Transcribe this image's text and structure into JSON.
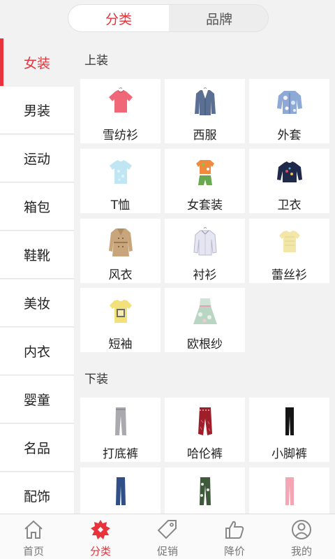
{
  "header": {
    "tabs": [
      {
        "label": "分类",
        "active": true
      },
      {
        "label": "品牌",
        "active": false
      }
    ]
  },
  "sidebar": {
    "items": [
      {
        "label": "女装",
        "active": true
      },
      {
        "label": "男装"
      },
      {
        "label": "运动"
      },
      {
        "label": "箱包"
      },
      {
        "label": "鞋靴"
      },
      {
        "label": "美妆"
      },
      {
        "label": "内衣"
      },
      {
        "label": "婴童"
      },
      {
        "label": "名品"
      },
      {
        "label": "配饰"
      }
    ]
  },
  "sections": [
    {
      "title": "上装",
      "items": [
        {
          "label": "雪纺衫",
          "icon": "chiffon-shirt-icon"
        },
        {
          "label": "西服",
          "icon": "blazer-icon"
        },
        {
          "label": "外套",
          "icon": "jacket-icon"
        },
        {
          "label": "T恤",
          "icon": "tshirt-icon"
        },
        {
          "label": "女套装",
          "icon": "women-suit-icon"
        },
        {
          "label": "卫衣",
          "icon": "sweatshirt-icon"
        },
        {
          "label": "风衣",
          "icon": "trench-coat-icon"
        },
        {
          "label": "衬衫",
          "icon": "shirt-icon"
        },
        {
          "label": "蕾丝衫",
          "icon": "lace-top-icon"
        },
        {
          "label": "短袖",
          "icon": "short-sleeve-icon"
        },
        {
          "label": "欧根纱",
          "icon": "organza-dress-icon"
        }
      ]
    },
    {
      "title": "下装",
      "items": [
        {
          "label": "打底裤",
          "icon": "leggings-icon"
        },
        {
          "label": "哈伦裤",
          "icon": "harem-pants-icon"
        },
        {
          "label": "小脚裤",
          "icon": "skinny-pants-icon"
        },
        {
          "label": "",
          "icon": "jeans-icon"
        },
        {
          "label": "",
          "icon": "camo-pants-icon"
        },
        {
          "label": "",
          "icon": "pink-pants-icon"
        }
      ]
    }
  ],
  "bottom_nav": [
    {
      "label": "首页",
      "icon": "home-icon"
    },
    {
      "label": "分类",
      "icon": "category-icon",
      "active": true
    },
    {
      "label": "促销",
      "icon": "tag-icon"
    },
    {
      "label": "降价",
      "icon": "thumbs-up-icon"
    },
    {
      "label": "我的",
      "icon": "user-icon"
    }
  ],
  "colors": {
    "accent": "#e8323c",
    "background": "#f2f2f2",
    "card": "#ffffff"
  }
}
